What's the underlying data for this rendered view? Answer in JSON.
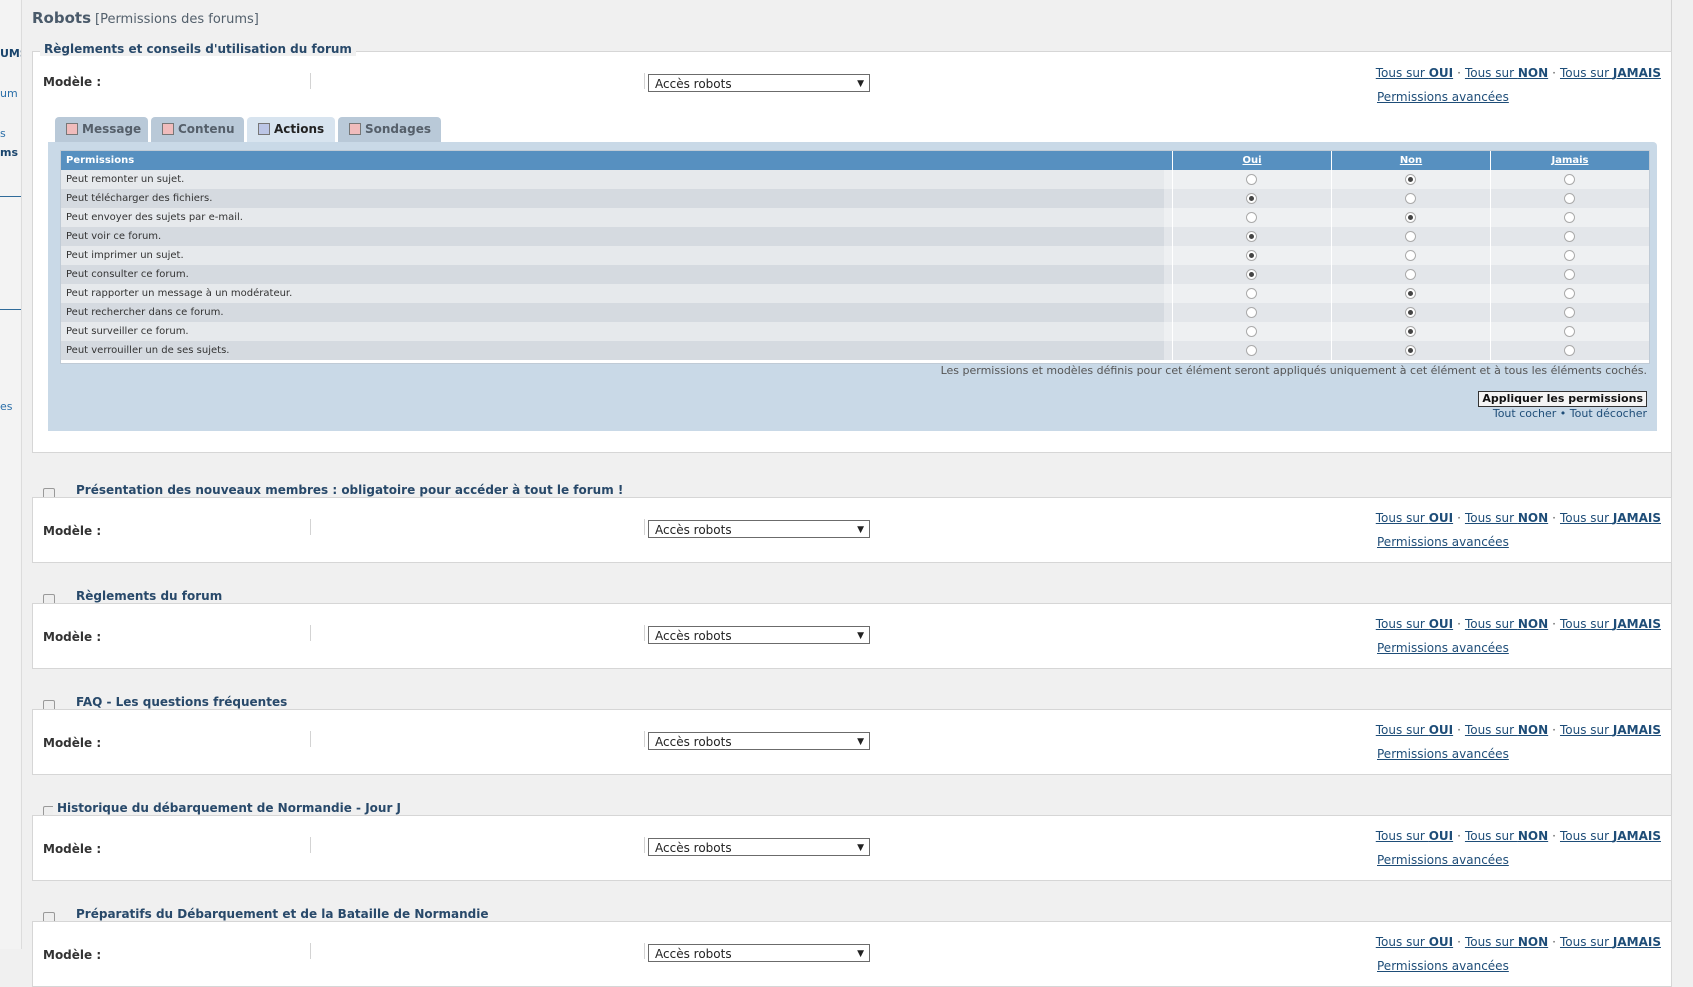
{
  "page": {
    "title": "Robots",
    "subtitle": "[Permissions des forums]"
  },
  "left_nav": [
    "UMS",
    "um",
    "s",
    "ms",
    "es"
  ],
  "common": {
    "modele_label": "Modèle :",
    "select_value": "Accès robots",
    "all_yes_prefix": "Tous sur ",
    "all_yes": "OUI",
    "all_no_prefix": "Tous sur ",
    "all_no": "NON",
    "all_never_prefix": "Tous sur ",
    "all_never": "JAMAIS",
    "separator": "·",
    "advanced": "Permissions avancées"
  },
  "expanded_forum": {
    "title": "Règlements et conseils d'utilisation du forum",
    "tabs": [
      {
        "label": "Message",
        "active": false
      },
      {
        "label": "Contenu",
        "active": false
      },
      {
        "label": "Actions",
        "active": true
      },
      {
        "label": "Sondages",
        "active": false
      }
    ],
    "table": {
      "headers": {
        "permissions": "Permissions",
        "yes": "Oui",
        "no": "Non",
        "never": "Jamais"
      },
      "rows": [
        {
          "label": "Peut remonter un sujet.",
          "value": "no"
        },
        {
          "label": "Peut télécharger des fichiers.",
          "value": "yes"
        },
        {
          "label": "Peut envoyer des sujets par e-mail.",
          "value": "no"
        },
        {
          "label": "Peut voir ce forum.",
          "value": "yes"
        },
        {
          "label": "Peut imprimer un sujet.",
          "value": "yes"
        },
        {
          "label": "Peut consulter ce forum.",
          "value": "yes"
        },
        {
          "label": "Peut rapporter un message à un modérateur.",
          "value": "no"
        },
        {
          "label": "Peut rechercher dans ce forum.",
          "value": "no"
        },
        {
          "label": "Peut surveiller ce forum.",
          "value": "no"
        },
        {
          "label": "Peut verrouiller un de ses sujets.",
          "value": "no"
        }
      ]
    },
    "note": "Les permissions et modèles définis pour cet élément seront appliqués uniquement à cet élément et à tous les éléments cochés.",
    "apply_button": "Appliquer les permissions",
    "check_all": "Tout cocher",
    "bullet": "•",
    "uncheck_all": "Tout décocher"
  },
  "forums": [
    {
      "title": "Présentation des nouveaux membres : obligatoire pour accéder à tout le forum !"
    },
    {
      "title": "Règlements du forum"
    },
    {
      "title": "FAQ - Les questions fréquentes"
    },
    {
      "title": "Historique du débarquement de Normandie - Jour J"
    },
    {
      "title": "Préparatifs du Débarquement et de la Bataille de Normandie"
    }
  ]
}
